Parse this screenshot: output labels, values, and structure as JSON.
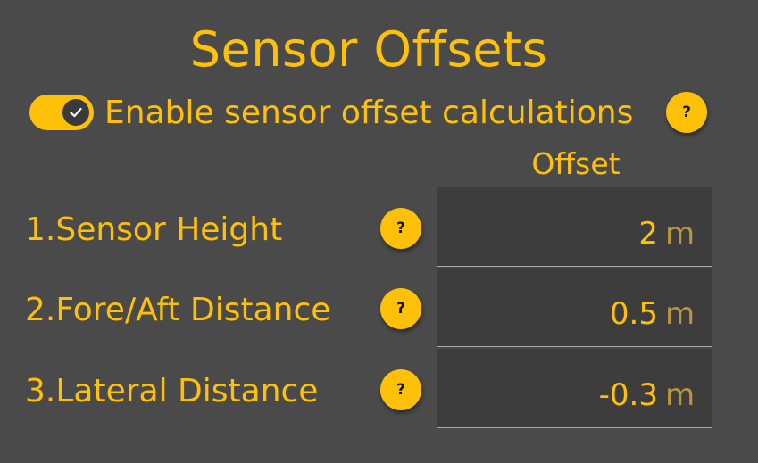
{
  "header": {
    "title": "Sensor Offsets"
  },
  "enable": {
    "label": "Enable sensor offset calculations",
    "checked": true,
    "help": "?"
  },
  "table": {
    "column_header": "Offset",
    "rows": [
      {
        "label": "1.Sensor Height",
        "value": "2",
        "unit": "m",
        "help": "?"
      },
      {
        "label": "2.Fore/Aft Distance",
        "value": "0.5",
        "unit": "m",
        "help": "?"
      },
      {
        "label": "3.Lateral Distance",
        "value": "-0.3",
        "unit": "m",
        "help": "?"
      }
    ]
  },
  "colors": {
    "background": "#4a4a4a",
    "accent": "#ffc107",
    "field_background": "#3d3d3d",
    "unit_text": "#b8963a"
  }
}
